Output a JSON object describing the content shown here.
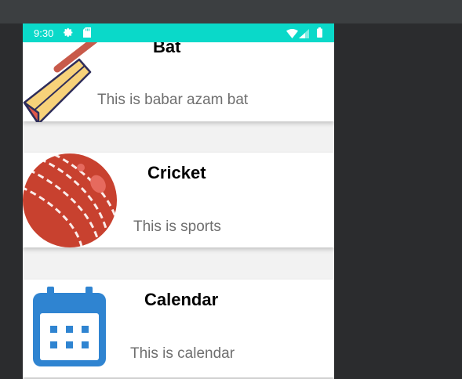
{
  "status_bar": {
    "time": "9:30"
  },
  "items": [
    {
      "title": "Bat",
      "description": "This is babar azam bat",
      "icon": "cricket-bat-icon"
    },
    {
      "title": "Cricket",
      "description": "This is sports",
      "icon": "cricket-ball-icon"
    },
    {
      "title": "Calendar",
      "description": "This is calendar",
      "icon": "calendar-icon"
    }
  ],
  "colors": {
    "status_bar": "#0ad9c9",
    "calendar_blue": "#2f84d1",
    "ball_red": "#c8412f",
    "bat_yellow": "#f7d27a"
  }
}
